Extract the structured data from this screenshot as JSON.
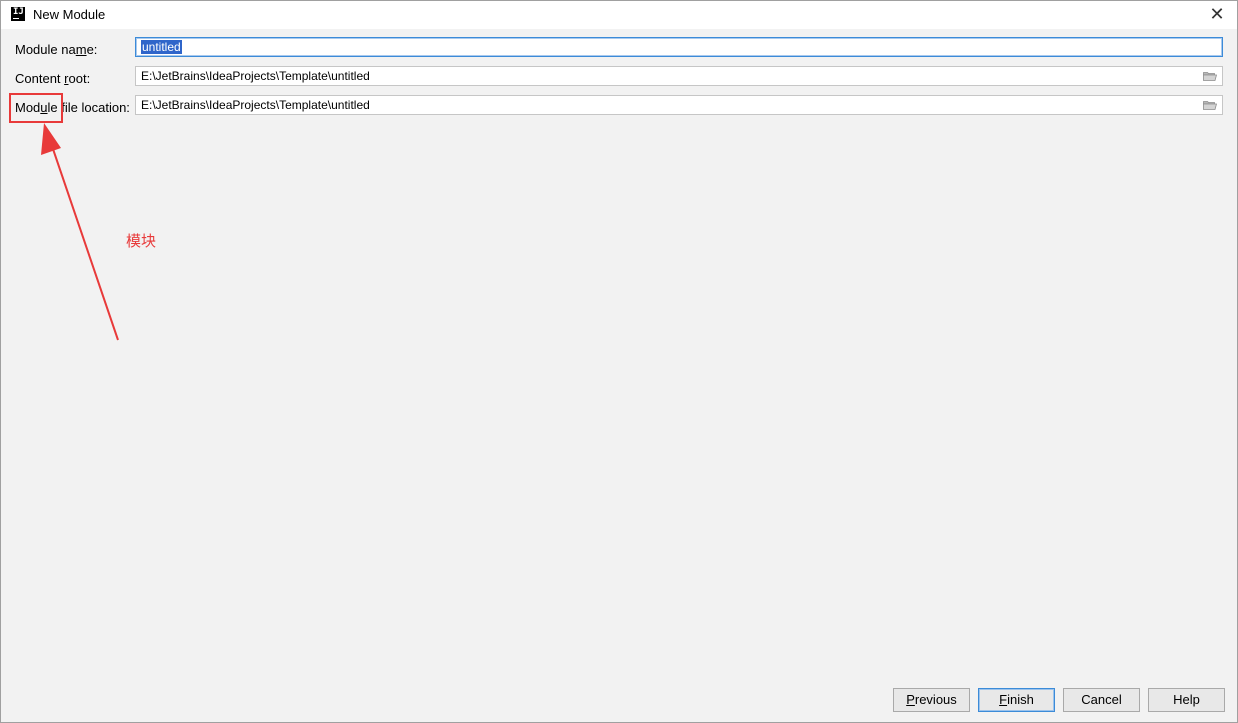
{
  "window": {
    "title": "New Module",
    "app_icon_text": "IJ",
    "close_glyph": "✕"
  },
  "form": {
    "module_name": {
      "label_prefix": "Module na",
      "label_ul": "m",
      "label_suffix": "e:",
      "value": "untitled"
    },
    "content_root": {
      "label_prefix": "Content ",
      "label_ul": "r",
      "label_suffix": "oot:",
      "value": "E:\\JetBrains\\IdeaProjects\\Template\\untitled"
    },
    "module_file_location": {
      "label_prefix": "Mod",
      "label_ul": "u",
      "label_suffix": "le file location:",
      "value": "E:\\JetBrains\\IdeaProjects\\Template\\untitled"
    }
  },
  "annotation": {
    "text": "模块",
    "color": "#e83a3a"
  },
  "buttons": {
    "previous": {
      "ul": "P",
      "rest": "revious"
    },
    "finish": {
      "ul": "F",
      "rest": "inish"
    },
    "cancel": {
      "label": "Cancel"
    },
    "help": {
      "label": "Help"
    }
  },
  "icons": {
    "folder": "folder-icon",
    "close": "close-icon",
    "app": "intellij-idea-icon"
  }
}
